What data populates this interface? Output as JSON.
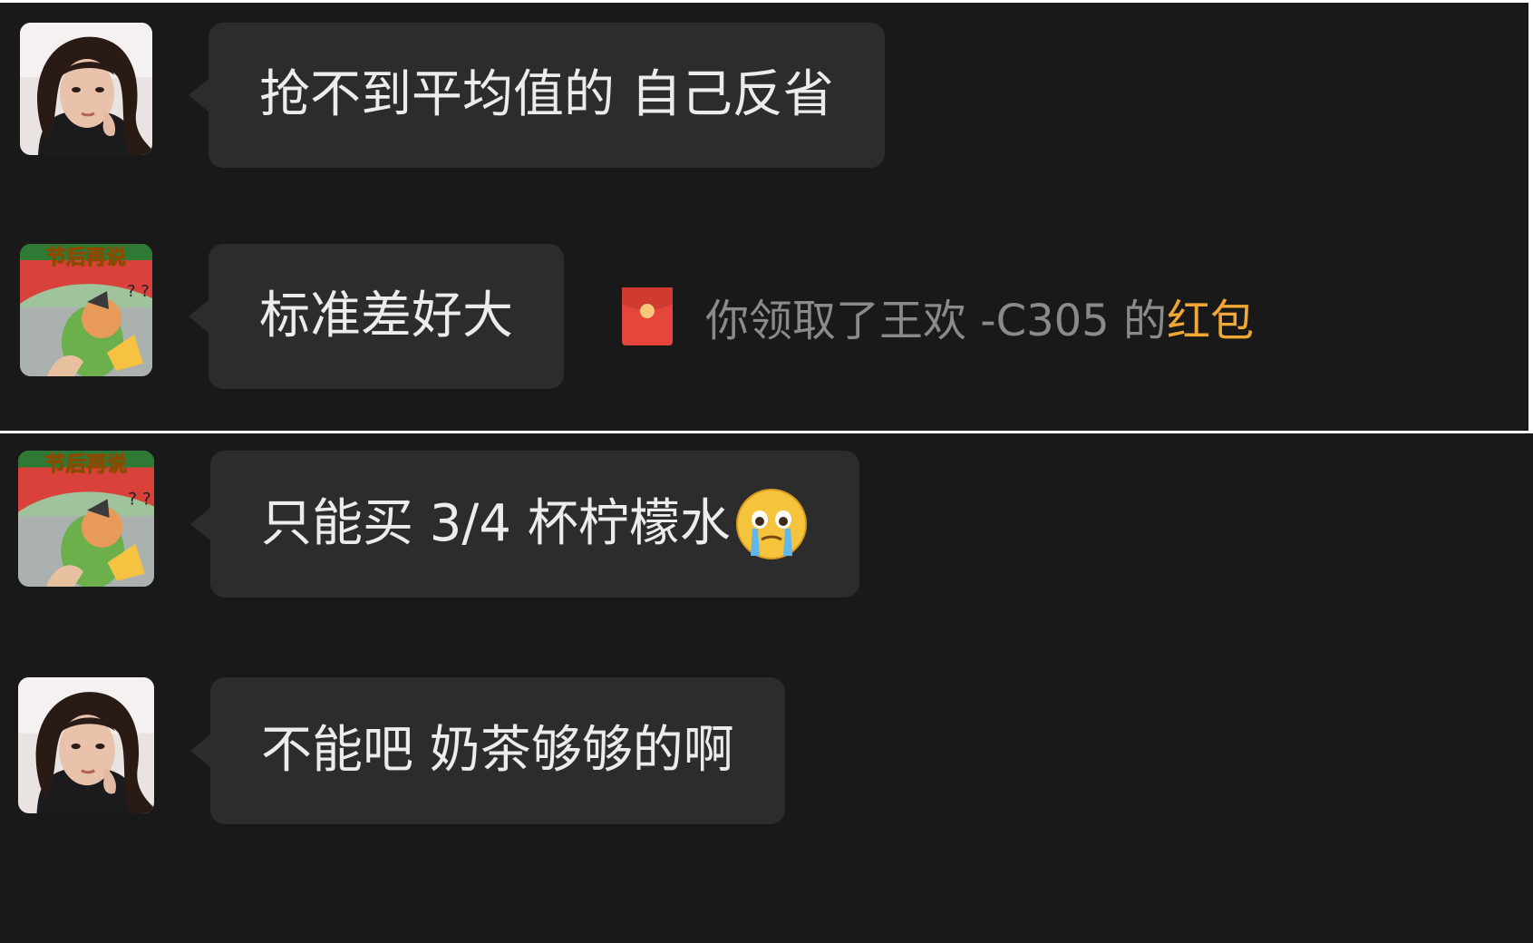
{
  "messages": [
    {
      "sender": "woman",
      "text": "抢不到平均值的 自己反省"
    },
    {
      "sender": "parrot",
      "text": "标准差好大"
    },
    {
      "sender": "parrot",
      "text": "只能买 3/4 杯柠檬水",
      "emoji": "crying-face-icon"
    },
    {
      "sender": "woman",
      "text": "不能吧 奶茶够够的啊"
    }
  ],
  "system_notice": {
    "icon": "red-envelope-icon",
    "text": "你领取了王欢 -C305 的",
    "link": "红包"
  },
  "avatars": {
    "parrot_caption": "节后再说"
  },
  "colors": {
    "background": "#191919",
    "bubble": "#2c2c2c",
    "message_text": "#ececec",
    "system_text": "#8a8a8a",
    "link_accent": "#f2a634",
    "envelope_red": "#e6453b"
  }
}
